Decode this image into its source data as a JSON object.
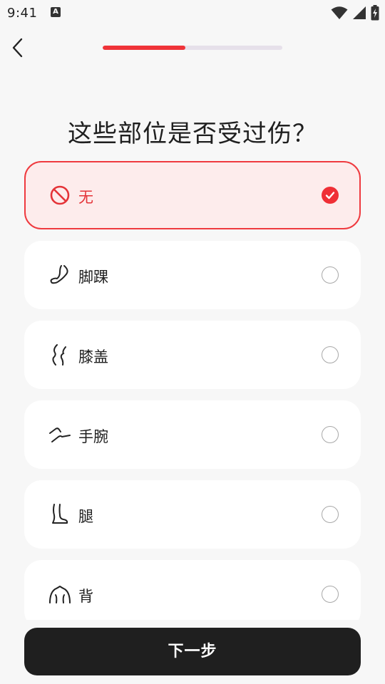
{
  "status_bar": {
    "time": "9:41",
    "notification_icon": "a-notification-icon",
    "wifi_icon": "wifi-icon",
    "signal_icon": "signal-icon",
    "battery_icon": "battery-charging-icon"
  },
  "nav": {
    "back_icon": "chevron-left-icon",
    "progress": 0.46,
    "progress_color": "#ef3339",
    "track_color": "#e6e0ea"
  },
  "title": "这些部位是否受过伤？",
  "options": [
    {
      "label": "无",
      "icon": "no-entry-icon",
      "selected": true
    },
    {
      "label": "脚踝",
      "icon": "ankle-icon",
      "selected": false
    },
    {
      "label": "膝盖",
      "icon": "knee-icon",
      "selected": false
    },
    {
      "label": "手腕",
      "icon": "wrist-icon",
      "selected": false
    },
    {
      "label": "腿",
      "icon": "leg-icon",
      "selected": false
    },
    {
      "label": "背",
      "icon": "back-icon",
      "selected": false
    }
  ],
  "next_button": "下一步",
  "colors": {
    "accent": "#ef3339",
    "selected_bg": "#fdecec",
    "button_bg": "#1f1f1f"
  }
}
